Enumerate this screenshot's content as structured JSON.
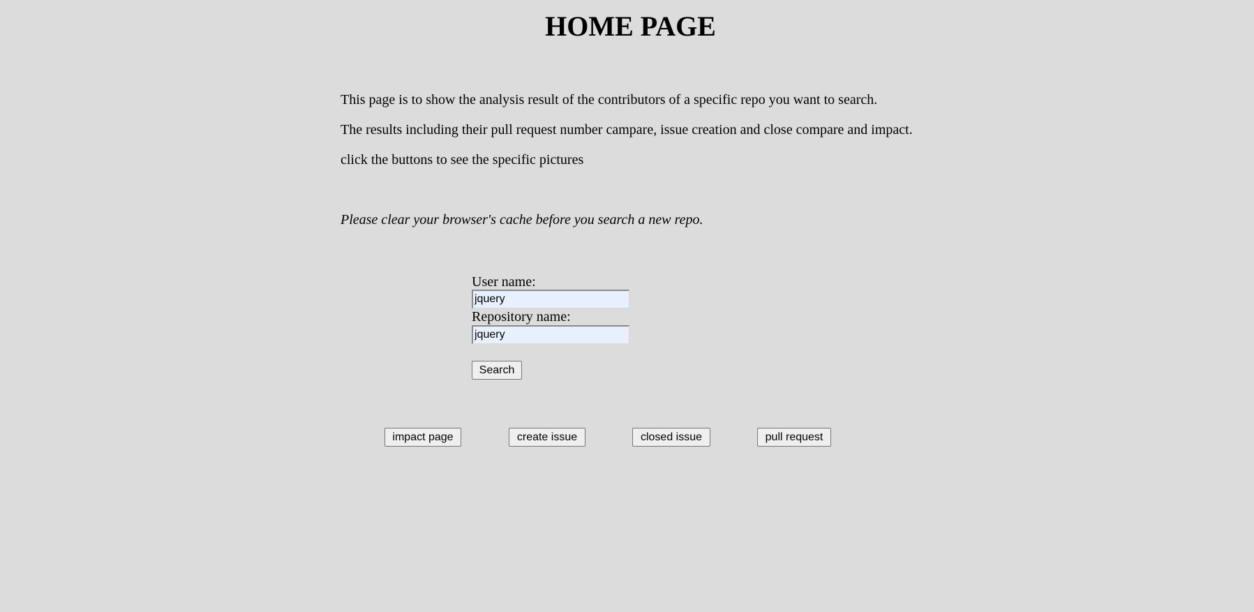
{
  "header": {
    "title": "HOME PAGE"
  },
  "intro": {
    "line1": "This page is to show the analysis result of the contributors of a specific repo you want to search.",
    "line2": "The results including their pull request number campare, issue creation and close compare and impact.",
    "line3": "click the buttons to see the specific pictures"
  },
  "note": "Please clear your browser's cache before you search a new repo.",
  "form": {
    "user_label": "User name:",
    "user_value": "jquery",
    "repo_label": "Repository name:",
    "repo_value": "jquery",
    "search_label": "Search"
  },
  "nav_buttons": {
    "impact": "impact page",
    "create": "create issue",
    "closed": "closed issue",
    "pull": "pull request"
  }
}
